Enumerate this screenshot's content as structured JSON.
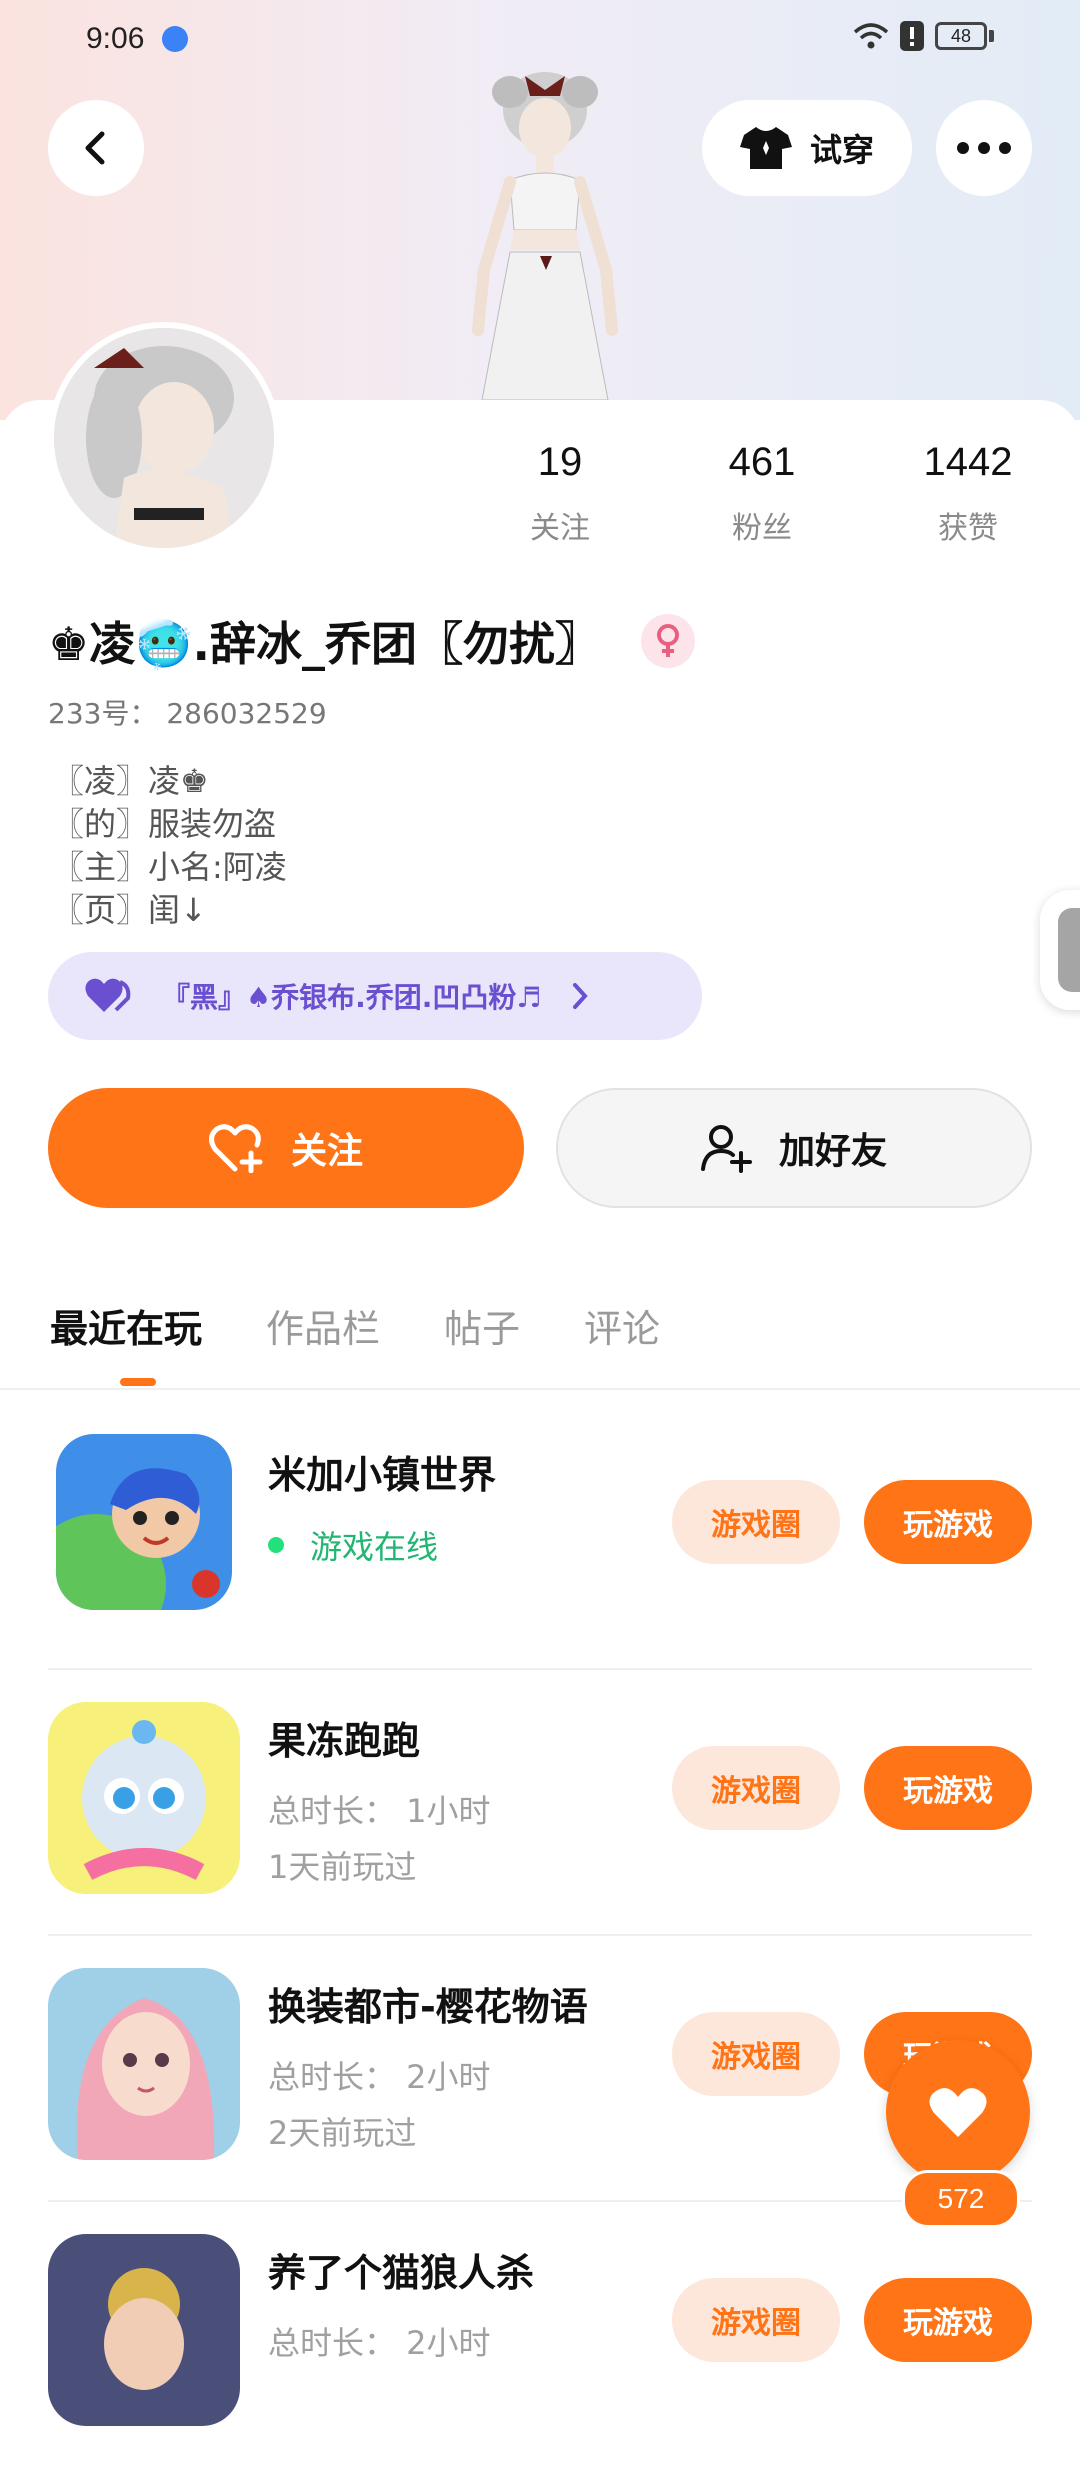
{
  "status_bar": {
    "time": "9:06",
    "battery": "48"
  },
  "header": {
    "try_on_label": "试穿"
  },
  "stats": [
    {
      "value": "19",
      "label": "关注"
    },
    {
      "value": "461",
      "label": "粉丝"
    },
    {
      "value": "1442",
      "label": "获赞"
    }
  ],
  "profile": {
    "username": "♚凌🥶.辞冰_乔团〖勿扰〗",
    "uid": "233号： 286032529",
    "bio": [
      "〖凌〗凌♚",
      "〖的〗服装勿盗",
      "〖主〗小名:阿凌",
      "〖页〗闺↓"
    ],
    "group_name": "『黑』♠乔银布.乔团.凹凸粉♬"
  },
  "actions": {
    "follow_label": "关注",
    "add_friend_label": "加好友"
  },
  "tabs": [
    "最近在玩",
    "作品栏",
    "帖子",
    "评论"
  ],
  "games": [
    {
      "name": "米加小镇世界",
      "status": "游戏在线",
      "online": true,
      "circle_label": "游戏圈",
      "play_label": "玩游戏"
    },
    {
      "name": "果冻跑跑",
      "duration": "总时长： 1小时",
      "last_played": "1天前玩过",
      "circle_label": "游戏圈",
      "play_label": "玩游戏"
    },
    {
      "name": "换装都市-樱花物语",
      "duration": "总时长： 2小时",
      "last_played": "2天前玩过",
      "circle_label": "游戏圈",
      "play_label": "玩游戏"
    },
    {
      "name": "养了个猫狼人杀",
      "duration": "总时长： 2小时",
      "circle_label": "游戏圈",
      "play_label": "玩游戏"
    }
  ],
  "fab": {
    "count": "572"
  },
  "colors": {
    "accent": "#ff7417",
    "online": "#22b573",
    "group_text": "#6b4fd1"
  }
}
